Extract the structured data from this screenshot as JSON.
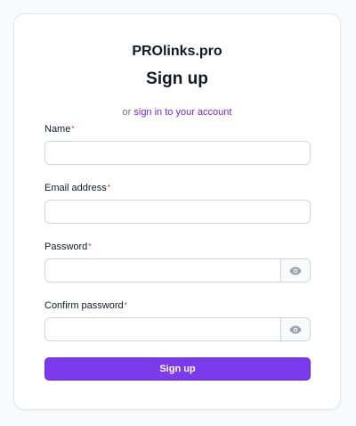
{
  "brand": "PROlinks.pro",
  "title": "Sign up",
  "subtitle": {
    "prefix": "or",
    "link_text": "sign in to your account"
  },
  "fields": {
    "name": {
      "label": "Name",
      "required_mark": "*",
      "value": "",
      "placeholder": ""
    },
    "email": {
      "label": "Email address",
      "required_mark": "*",
      "value": "",
      "placeholder": ""
    },
    "password": {
      "label": "Password",
      "required_mark": "*",
      "value": "",
      "placeholder": "",
      "toggle_icon": "eye-icon"
    },
    "confirm_password": {
      "label": "Confirm password",
      "required_mark": "*",
      "value": "",
      "placeholder": "",
      "toggle_icon": "eye-icon"
    }
  },
  "submit_label": "Sign up",
  "colors": {
    "accent": "#7c3aed",
    "link": "#6d28d9",
    "required": "#dc2626",
    "icon": "#9ca3af"
  }
}
